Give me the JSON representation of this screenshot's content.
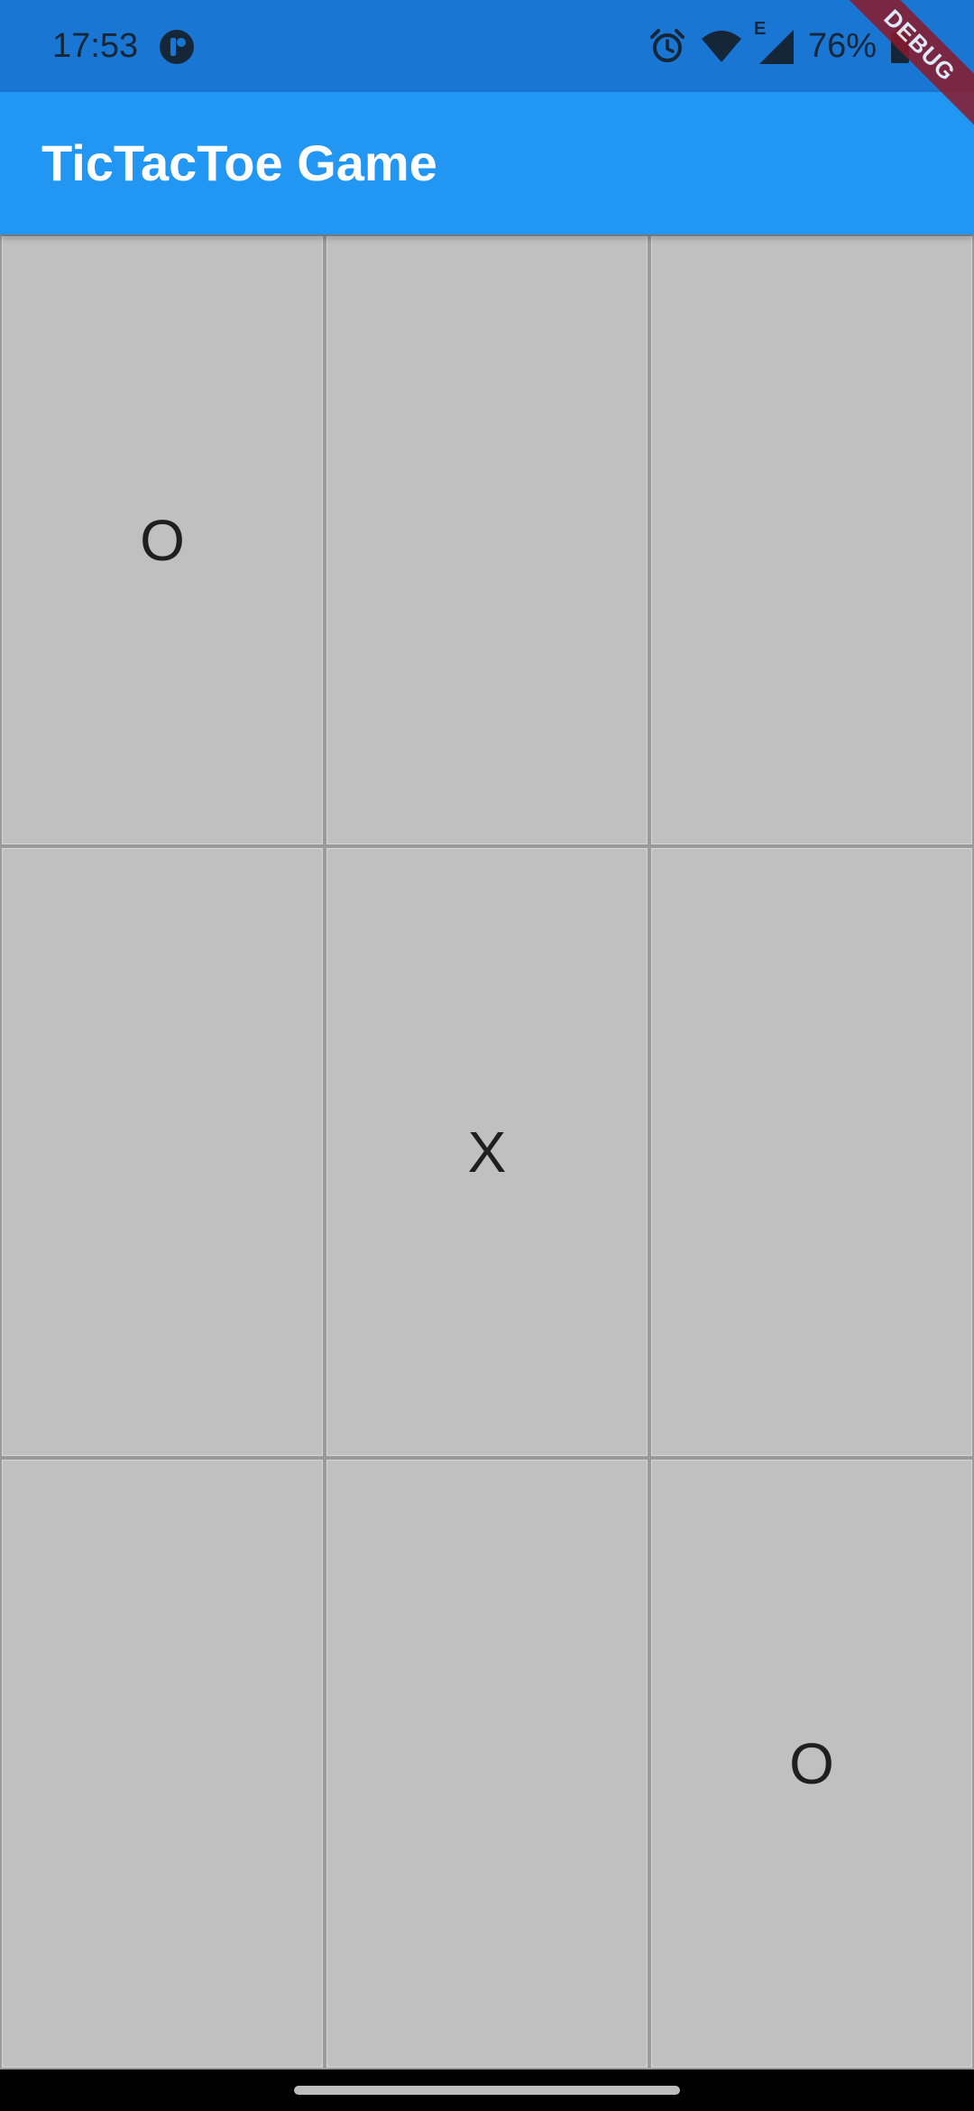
{
  "status_bar": {
    "time": "17:53",
    "battery_percent": "76%",
    "network_label": "E",
    "icons": [
      "app-notification-icon",
      "alarm-icon",
      "wifi-icon",
      "cell-signal-icon",
      "battery-icon"
    ]
  },
  "app_bar": {
    "title": "TicTacToe Game",
    "color": "#2196f3"
  },
  "debug_banner": {
    "label": "DEBUG"
  },
  "board": {
    "cells": [
      {
        "mark": "O"
      },
      {
        "mark": ""
      },
      {
        "mark": ""
      },
      {
        "mark": ""
      },
      {
        "mark": "X"
      },
      {
        "mark": ""
      },
      {
        "mark": ""
      },
      {
        "mark": ""
      },
      {
        "mark": "O"
      }
    ],
    "cell_color": "#c0c0c0"
  }
}
